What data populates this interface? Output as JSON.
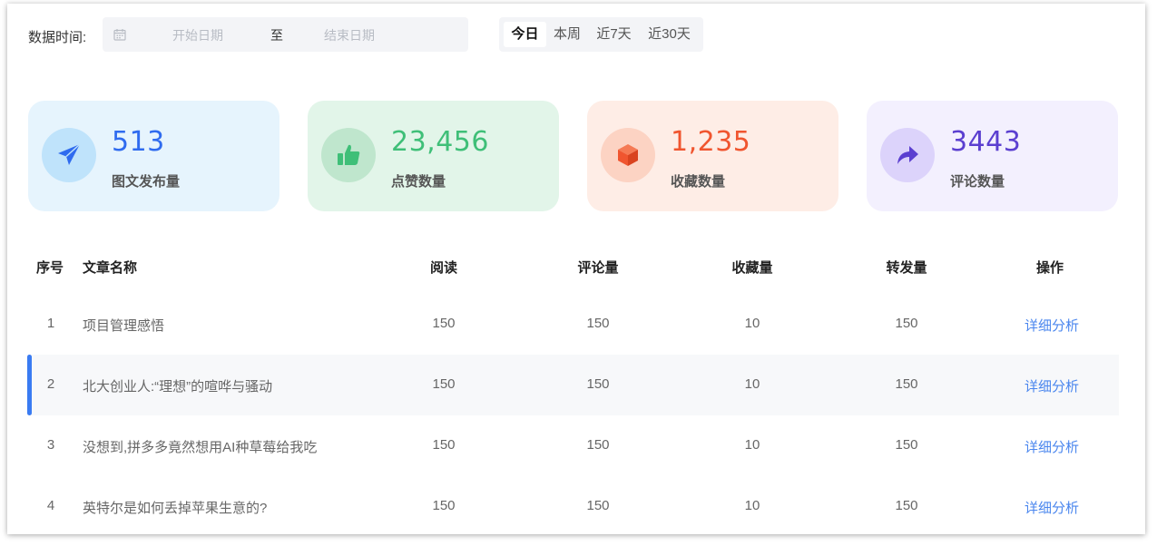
{
  "filter": {
    "label": "数据时间:",
    "start_placeholder": "开始日期",
    "separator": "至",
    "end_placeholder": "结束日期",
    "quick_ranges": [
      "今日",
      "本周",
      "近7天",
      "近30天"
    ],
    "active_range": "今日"
  },
  "stats": [
    {
      "value": "513",
      "label": "图文发布量",
      "icon": "paper-plane-icon",
      "color": "#2f6bef",
      "bg": "#e6f4fd",
      "circle": "#bfe3fb"
    },
    {
      "value": "23,456",
      "label": "点赞数量",
      "icon": "thumbs-up-icon",
      "color": "#3fbf78",
      "bg": "#e2f5e9",
      "circle": "#bfe6cd"
    },
    {
      "value": "1,235",
      "label": "收藏数量",
      "icon": "cube-icon",
      "color": "#f0552f",
      "bg": "#feede6",
      "circle": "#fcd3c3"
    },
    {
      "value": "3443",
      "label": "评论数量",
      "icon": "share-arrow-icon",
      "color": "#5b3fd0",
      "bg": "#f3f0fe",
      "circle": "#dcd3fb"
    }
  ],
  "table": {
    "headers": {
      "index": "序号",
      "title": "文章名称",
      "reads": "阅读",
      "comments": "评论量",
      "favorites": "收藏量",
      "shares": "转发量",
      "action": "操作"
    },
    "rows": [
      {
        "index": "1",
        "title": "项目管理感悟",
        "reads": "150",
        "comments": "150",
        "favorites": "10",
        "shares": "150",
        "action": "详细分析"
      },
      {
        "index": "2",
        "title": "北大创业人:“理想”的喧哗与骚动",
        "reads": "150",
        "comments": "150",
        "favorites": "10",
        "shares": "150",
        "action": "详细分析"
      },
      {
        "index": "3",
        "title": "没想到,拼多多竟然想用AI种草莓给我吃",
        "reads": "150",
        "comments": "150",
        "favorites": "10",
        "shares": "150",
        "action": "详细分析"
      },
      {
        "index": "4",
        "title": "英特尔是如何丢掉苹果生意的?",
        "reads": "150",
        "comments": "150",
        "favorites": "10",
        "shares": "150",
        "action": "详细分析"
      }
    ],
    "highlighted_row": 2
  }
}
